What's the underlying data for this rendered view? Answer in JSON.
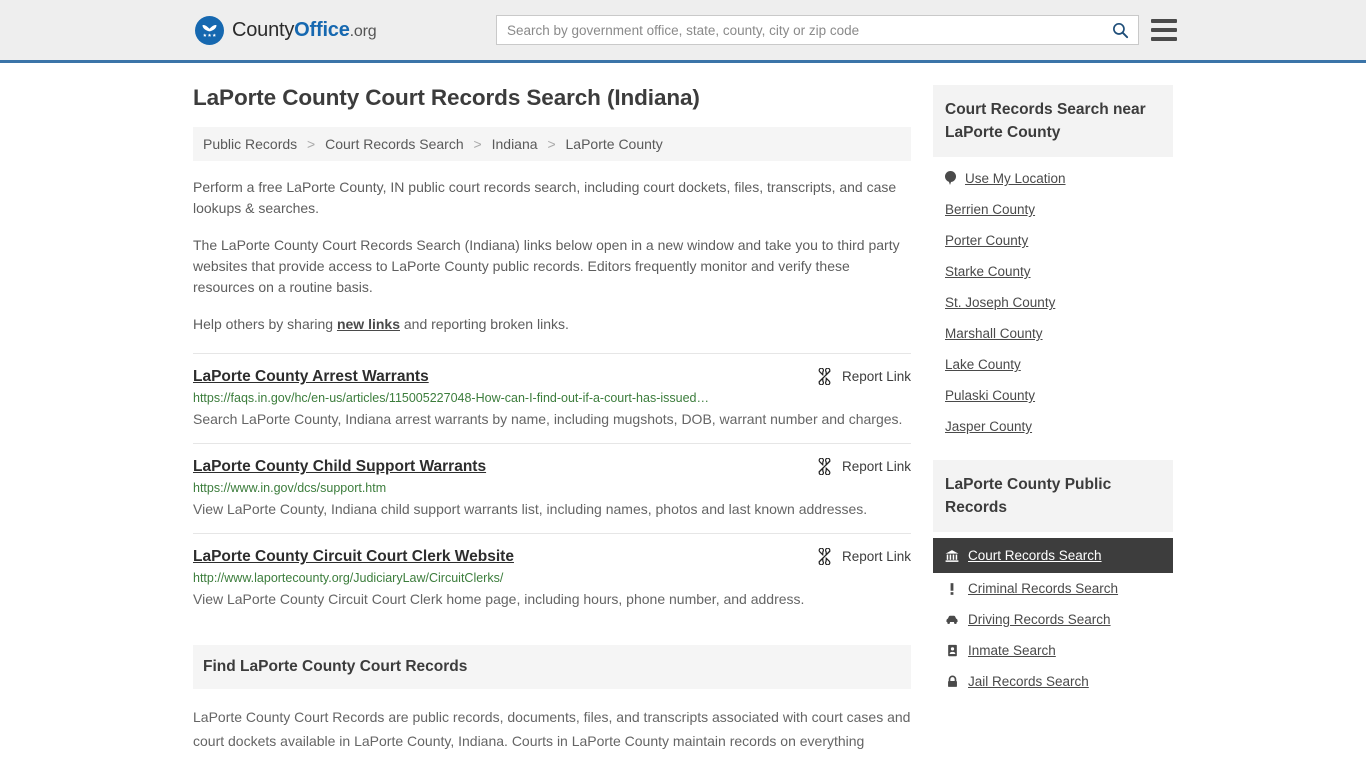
{
  "header": {
    "brand": {
      "part1": "County",
      "part2": "Office",
      "tld": ".org"
    },
    "search": {
      "placeholder": "Search by government office, state, county, city or zip code",
      "value": "",
      "button_icon": "search-icon"
    },
    "menu_icon": "hamburger-menu-icon",
    "accent_color": "#3b74a8"
  },
  "page_title": "LaPorte County Court Records Search (Indiana)",
  "breadcrumb": {
    "separator": ">",
    "items": [
      {
        "label": "Public Records"
      },
      {
        "label": "Court Records Search"
      },
      {
        "label": "Indiana"
      },
      {
        "label": "LaPorte County"
      }
    ]
  },
  "intro": {
    "p1": "Perform a free LaPorte County, IN public court records search, including court dockets, files, transcripts, and case lookups & searches.",
    "p2": "The LaPorte County Court Records Search (Indiana) links below open in a new window and take you to third party websites that provide access to LaPorte County public records. Editors frequently monitor and verify these resources on a routine basis.",
    "p3_before": "Help others by sharing ",
    "p3_link": "new links",
    "p3_after": " and reporting broken links."
  },
  "report_link_label": "Report Link",
  "report_link_icon": "broken-chain-icon",
  "results": [
    {
      "title": "LaPorte County Arrest Warrants",
      "url": "https://faqs.in.gov/hc/en-us/articles/115005227048-How-can-I-find-out-if-a-court-has-issued…",
      "description": "Search LaPorte County, Indiana arrest warrants by name, including mugshots, DOB, warrant number and charges."
    },
    {
      "title": "LaPorte County Child Support Warrants",
      "url": "https://www.in.gov/dcs/support.htm",
      "description": "View LaPorte County, Indiana child support warrants list, including names, photos and last known addresses."
    },
    {
      "title": "LaPorte County Circuit Court Clerk Website",
      "url": "http://www.laportecounty.org/JudiciaryLaw/CircuitClerks/",
      "description": "View LaPorte County Circuit Court Clerk home page, including hours, phone number, and address."
    }
  ],
  "find_section": {
    "heading": "Find LaPorte County Court Records",
    "paragraph": "LaPorte County Court Records are public records, documents, files, and transcripts associated with court cases and court dockets available in LaPorte County, Indiana. Courts in LaPorte County maintain records on everything"
  },
  "sidebar": {
    "nearby": {
      "title": "Court Records Search near LaPorte County",
      "items": [
        {
          "label": "Use My Location",
          "icon": "map-pin-icon"
        },
        {
          "label": "Berrien County",
          "icon": ""
        },
        {
          "label": "Porter County",
          "icon": ""
        },
        {
          "label": "Starke County",
          "icon": ""
        },
        {
          "label": "St. Joseph County",
          "icon": ""
        },
        {
          "label": "Marshall County",
          "icon": ""
        },
        {
          "label": "Lake County",
          "icon": ""
        },
        {
          "label": "Pulaski County",
          "icon": ""
        },
        {
          "label": "Jasper County",
          "icon": ""
        }
      ]
    },
    "public_records": {
      "title": "LaPorte County Public Records",
      "items": [
        {
          "label": "Court Records Search",
          "icon": "bank-icon",
          "active": true
        },
        {
          "label": "Criminal Records Search",
          "icon": "exclamation-icon",
          "active": false
        },
        {
          "label": "Driving Records Search",
          "icon": "car-icon",
          "active": false
        },
        {
          "label": "Inmate Search",
          "icon": "id-card-icon",
          "active": false
        },
        {
          "label": "Jail Records Search",
          "icon": "lock-icon",
          "active": false
        }
      ]
    }
  }
}
